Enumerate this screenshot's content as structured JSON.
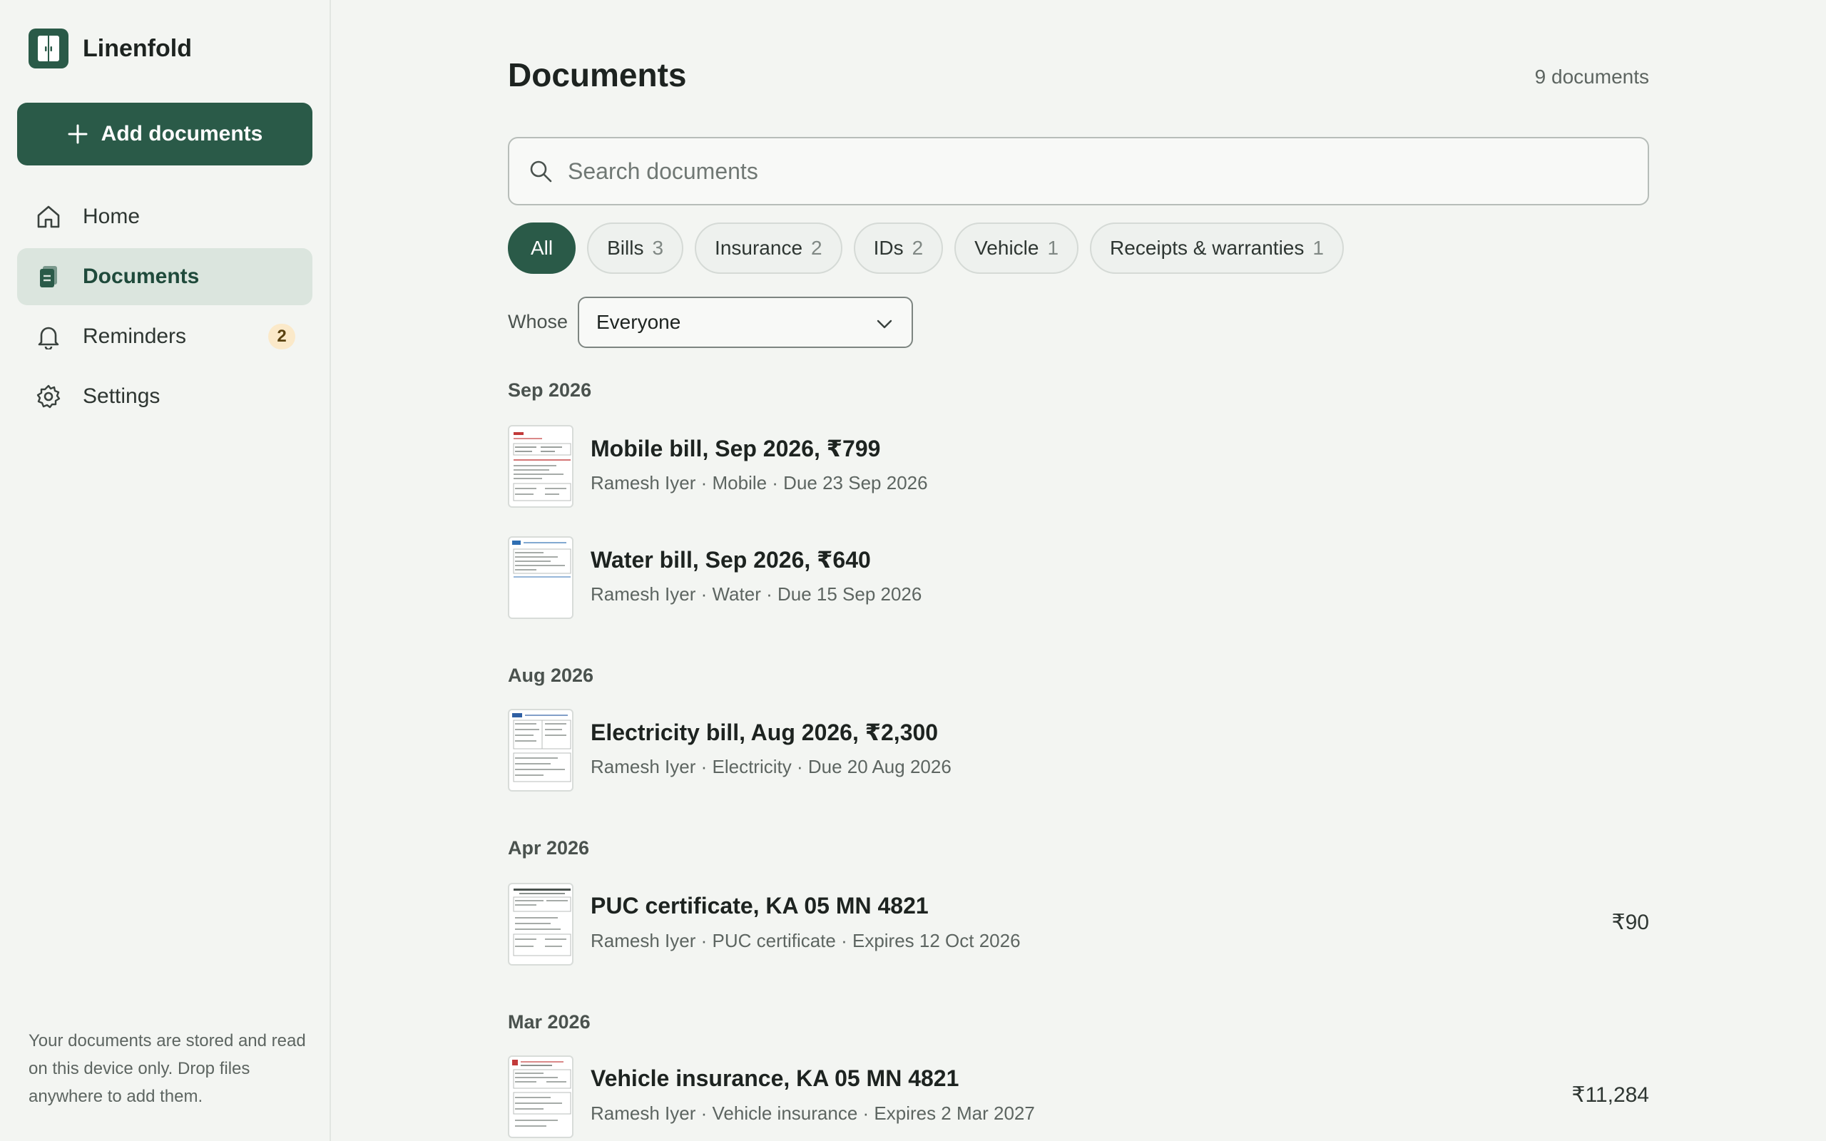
{
  "app": {
    "name": "Linenfold",
    "add_button": "Add documents"
  },
  "nav": {
    "items": [
      {
        "label": "Home",
        "icon": "home-icon"
      },
      {
        "label": "Documents",
        "icon": "documents-icon",
        "active": true
      },
      {
        "label": "Reminders",
        "icon": "bell-icon",
        "badge": "2"
      },
      {
        "label": "Settings",
        "icon": "gear-icon"
      }
    ]
  },
  "sidebar_note": "Your documents are stored and read on this device only. Drop files anywhere to add them.",
  "page": {
    "title": "Documents",
    "count": "9 documents"
  },
  "search": {
    "placeholder": "Search documents",
    "value": ""
  },
  "filters": [
    {
      "label": "All",
      "count": "",
      "active": true
    },
    {
      "label": "Bills",
      "count": "3"
    },
    {
      "label": "Insurance",
      "count": "2"
    },
    {
      "label": "IDs",
      "count": "2"
    },
    {
      "label": "Vehicle",
      "count": "1"
    },
    {
      "label": "Receipts & warranties",
      "count": "1"
    }
  ],
  "whose": {
    "label": "Whose",
    "selected": "Everyone"
  },
  "groups": [
    {
      "title": "Sep 2026",
      "docs": [
        {
          "title": "Mobile bill, Sep 2026, ₹799",
          "meta": "Ramesh Iyer · Mobile · Due 23 Sep 2026",
          "amount": ""
        },
        {
          "title": "Water bill, Sep 2026, ₹640",
          "meta": "Ramesh Iyer · Water · Due 15 Sep 2026",
          "amount": ""
        }
      ]
    },
    {
      "title": "Aug 2026",
      "docs": [
        {
          "title": "Electricity bill, Aug 2026, ₹2,300",
          "meta": "Ramesh Iyer · Electricity · Due 20 Aug 2026",
          "amount": ""
        }
      ]
    },
    {
      "title": "Apr 2026",
      "docs": [
        {
          "title": "PUC certificate, KA 05 MN 4821",
          "meta": "Ramesh Iyer · PUC certificate · Expires 12 Oct 2026",
          "amount": "₹90"
        }
      ]
    },
    {
      "title": "Mar 2026",
      "docs": [
        {
          "title": "Vehicle insurance, KA 05 MN 4821",
          "meta": "Ramesh Iyer · Vehicle insurance · Expires 2 Mar 2027",
          "amount": "₹11,284"
        }
      ]
    }
  ],
  "colors": {
    "accent": "#2a5a48",
    "active_nav_bg": "#dbe5de",
    "badge_bg": "#fbe9c9",
    "background": "#f3f5f2"
  }
}
